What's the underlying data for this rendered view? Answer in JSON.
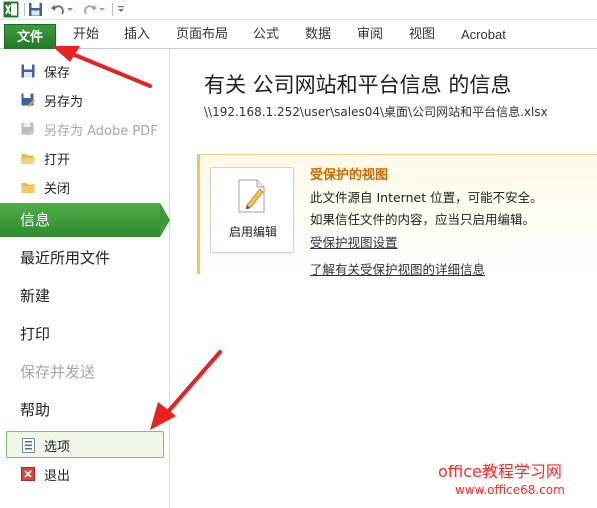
{
  "ribbon": {
    "file_tab": "文件",
    "tabs": [
      "开始",
      "插入",
      "页面布局",
      "公式",
      "数据",
      "审阅",
      "视图",
      "Acrobat"
    ]
  },
  "nav": {
    "save": "保存",
    "save_as": "另存为",
    "save_as_pdf": "另存为 Adobe PDF",
    "open": "打开",
    "close": "关闭",
    "info": "信息",
    "recent": "最近所用文件",
    "new": "新建",
    "print": "打印",
    "save_send": "保存并发送",
    "help": "帮助",
    "options": "选项",
    "exit": "退出"
  },
  "info": {
    "title": "有关 公司网站和平台信息 的信息",
    "path": "\\\\192.168.1.252\\user\\sales04\\桌面\\公司网站和平台信息.xlsx"
  },
  "protected_view": {
    "enable_label": "启用编辑",
    "title": "受保护的视图",
    "line1": "此文件源自 Internet 位置，可能不安全。",
    "line2": "如果信任文件的内容，应当只启用编辑。",
    "settings_link": "受保护视图设置",
    "learn_more_link": "了解有关受保护视图的详细信息"
  },
  "watermark": {
    "line1": "office教程学习网",
    "line2": "www.office68.com"
  },
  "colors": {
    "file_tab": "#2a8a2e",
    "nav_selected": "#3a9a3a",
    "protect_title": "#cc6a00",
    "annotation_arrow": "#e8231f",
    "watermark": "#ff2a2a"
  },
  "icons": {
    "app": "excel-icon",
    "save": "floppy-icon",
    "save_as": "save-as-icon",
    "pdf": "pdf-icon",
    "open": "folder-open-icon",
    "close": "folder-close-icon",
    "options": "options-icon",
    "exit": "exit-icon",
    "enable": "document-edit-icon"
  }
}
